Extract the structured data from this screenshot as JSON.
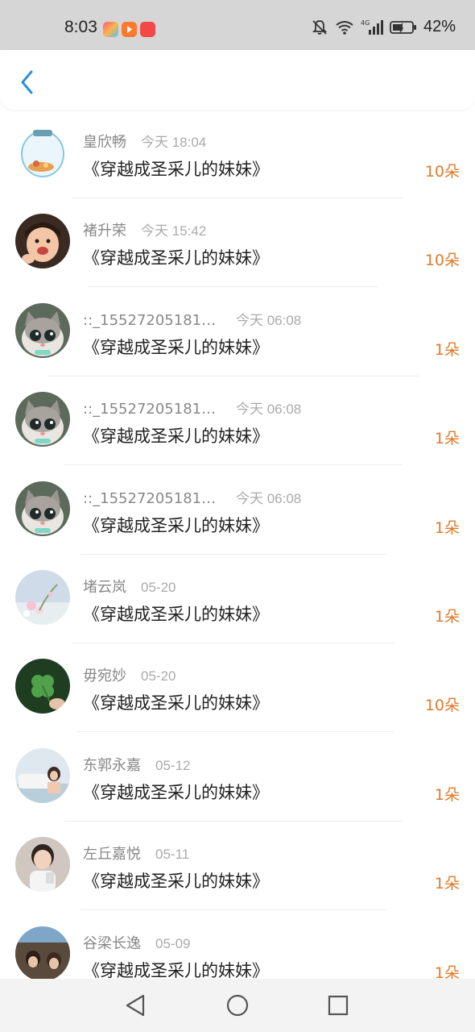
{
  "status_bar": {
    "time": "8:03",
    "battery_pct": "42%"
  },
  "header": {
    "back_icon": "chevron-left-icon"
  },
  "colors": {
    "accent_blue": "#2e8fdc",
    "count_orange": "#e07a2a"
  },
  "gifts": [
    {
      "user": "皇欣畅",
      "time": "今天 18:04",
      "book": "《穿越成圣采儿的妹妹》",
      "count": "10朵"
    },
    {
      "user": "褚升荣",
      "time": "今天 15:42",
      "book": "《穿越成圣采儿的妹妹》",
      "count": "10朵"
    },
    {
      "user": "::_155272051812...",
      "time": "今天 06:08",
      "book": "《穿越成圣采儿的妹妹》",
      "count": "1朵"
    },
    {
      "user": "::_155272051812...",
      "time": "今天 06:08",
      "book": "《穿越成圣采儿的妹妹》",
      "count": "1朵"
    },
    {
      "user": "::_155272051812...",
      "time": "今天 06:08",
      "book": "《穿越成圣采儿的妹妹》",
      "count": "1朵"
    },
    {
      "user": "堵云岚",
      "time": "05-20",
      "book": "《穿越成圣采儿的妹妹》",
      "count": "1朵"
    },
    {
      "user": "毋宛妙",
      "time": "05-20",
      "book": "《穿越成圣采儿的妹妹》",
      "count": "10朵"
    },
    {
      "user": "东郭永嘉",
      "time": "05-12",
      "book": "《穿越成圣采儿的妹妹》",
      "count": "1朵"
    },
    {
      "user": "左丘嘉悦",
      "time": "05-11",
      "book": "《穿越成圣采儿的妹妹》",
      "count": "1朵"
    },
    {
      "user": "谷梁长逸",
      "time": "05-09",
      "book": "《穿越成圣采儿的妹妹》",
      "count": "1朵"
    }
  ],
  "nav": {
    "back": "triangle-back-icon",
    "home": "circle-home-icon",
    "recents": "square-recents-icon"
  }
}
